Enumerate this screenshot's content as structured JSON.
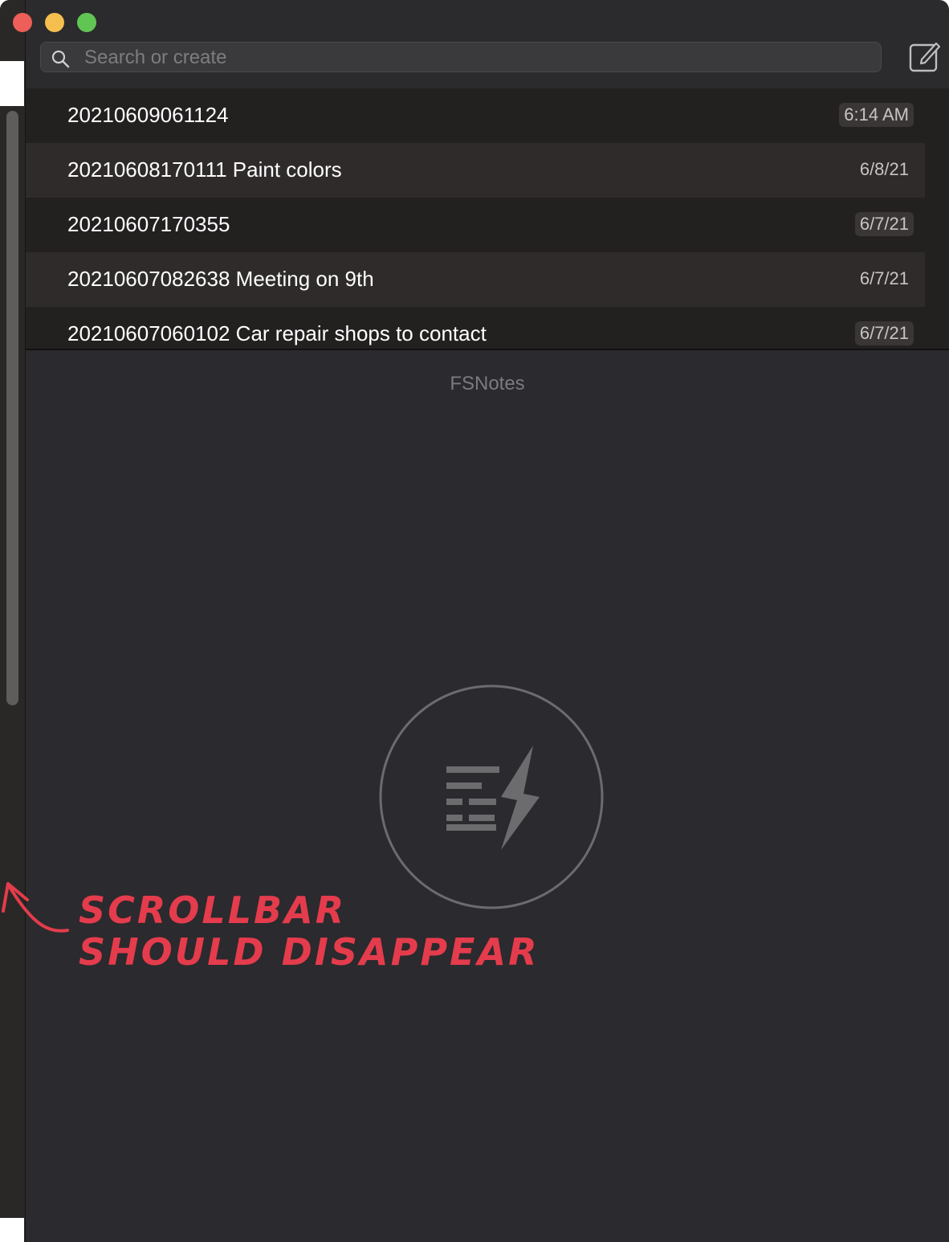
{
  "search": {
    "placeholder": "Search or create"
  },
  "notes": [
    {
      "title": "20210609061124",
      "date": "6:14 AM"
    },
    {
      "title": "20210608170111 Paint colors",
      "date": "6/8/21"
    },
    {
      "title": "20210607170355",
      "date": "6/7/21"
    },
    {
      "title": "20210607082638 Meeting on 9th",
      "date": "6/7/21"
    },
    {
      "title": "20210607060102 Car repair shops to contact",
      "date": "6/7/21"
    }
  ],
  "editor": {
    "placeholder_title": "FSNotes",
    "logo_icon": "fsnotes-logo-icon"
  },
  "annotation": {
    "line1": "SCROLLBAR",
    "line2": "SHOULD  DISAPPEAR"
  },
  "colors": {
    "annotation": "#e43c4c",
    "close": "#ed5f58",
    "minimize": "#f4bf4f",
    "zoom": "#61c554"
  }
}
